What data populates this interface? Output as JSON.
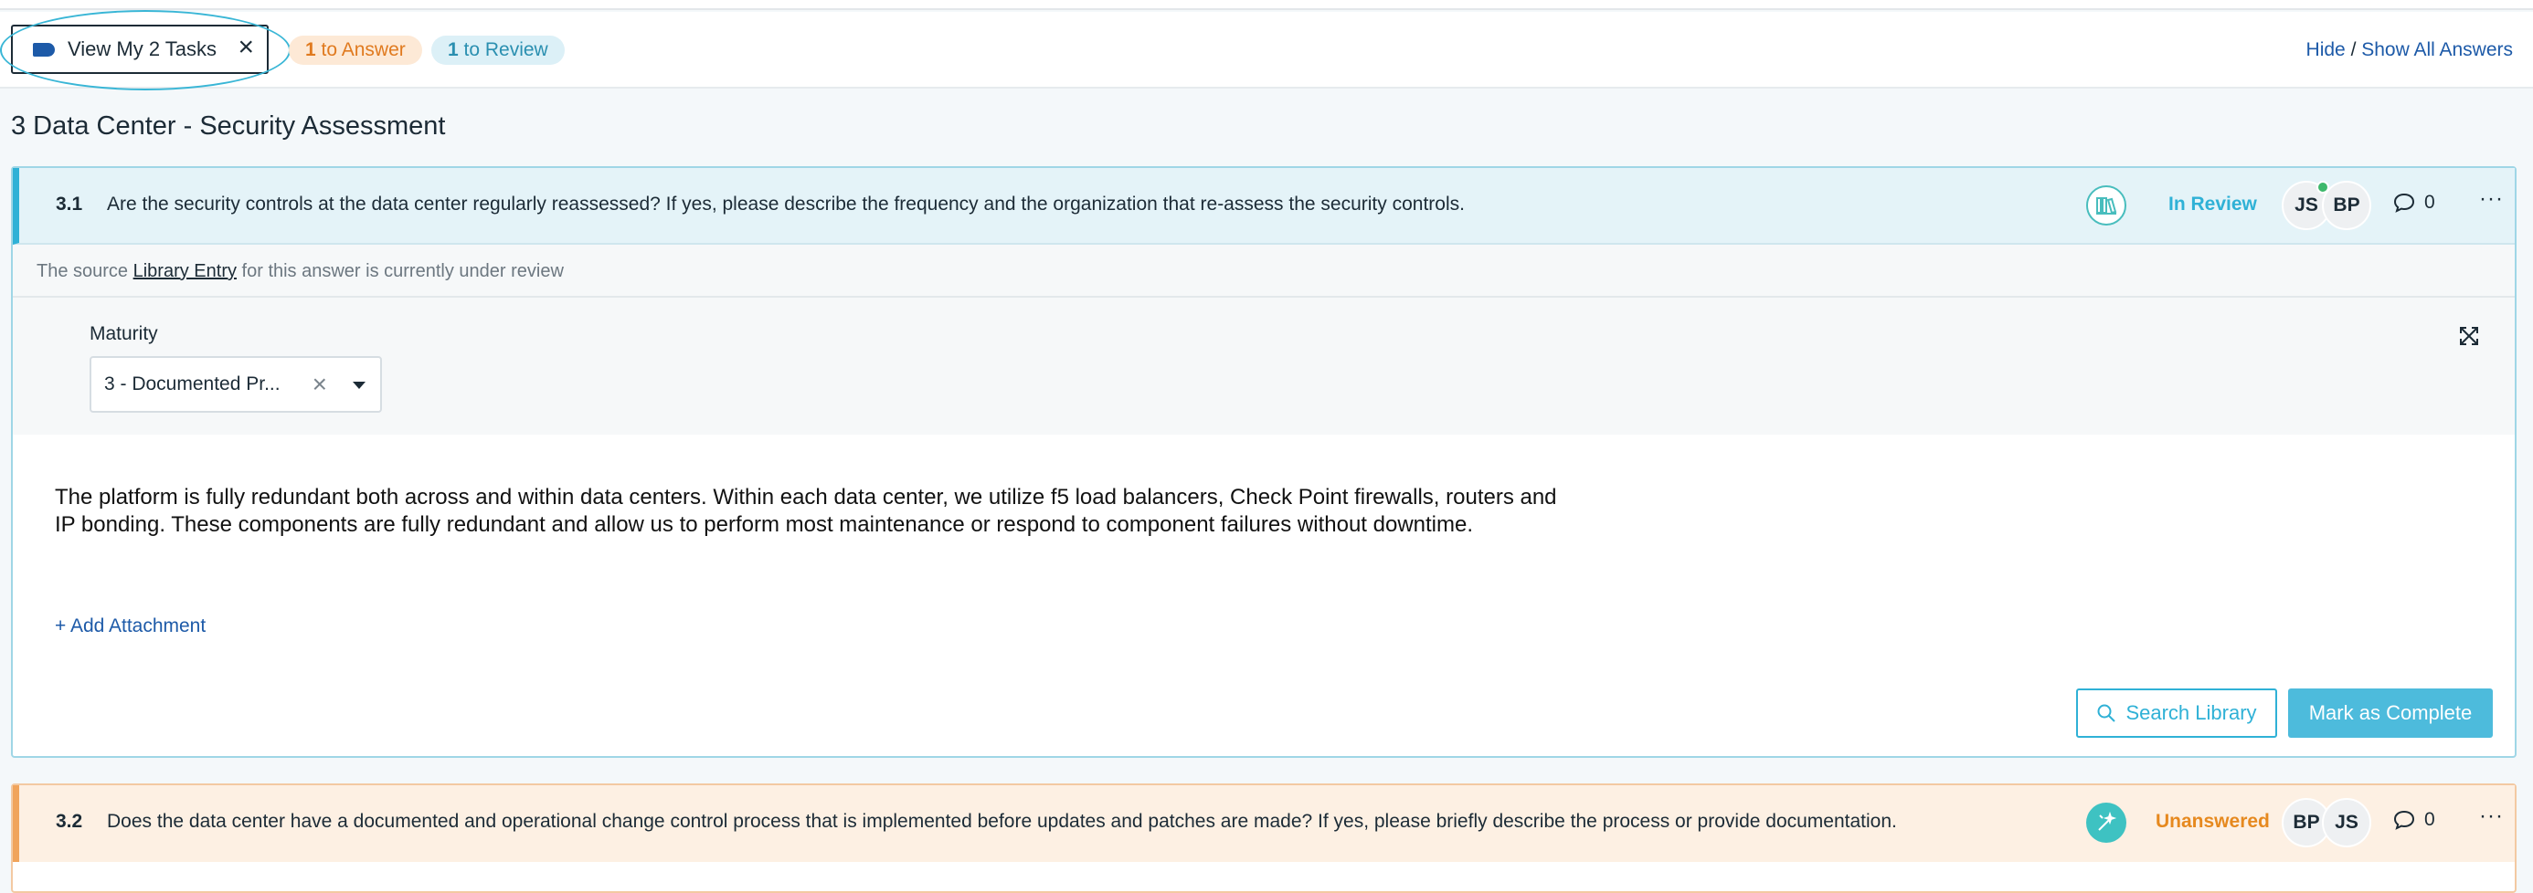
{
  "toolbar": {
    "view_tasks_label": "View My 2 Tasks",
    "to_answer_count": "1",
    "to_answer_label": " to Answer",
    "to_review_count": "1",
    "to_review_label": " to Review",
    "hide_label": "Hide",
    "separator": " / ",
    "show_all_label": "Show All Answers"
  },
  "section": {
    "title": "3 Data Center - Security Assessment"
  },
  "questions": [
    {
      "number": "3.1",
      "text": "Are the security controls at the data center regularly reassessed? If yes, please describe the frequency and the organization that re-assess the security controls.",
      "status": "In Review",
      "avatars": [
        "JS",
        "BP"
      ],
      "comment_count": "0",
      "source_prefix": "The source ",
      "source_link": "Library Entry",
      "source_suffix": " for this answer is currently under review",
      "maturity_label": "Maturity",
      "maturity_value": "3 - Documented Pr...",
      "answer": "The platform is fully redundant both across and within data centers. Within each data center, we utilize f5 load balancers, Check Point firewalls, routers and IP bonding. These components are fully redundant and allow us to perform most maintenance or respond to component failures without downtime.",
      "add_attachment": "+ Add Attachment",
      "search_library": "Search Library",
      "mark_complete": "Mark as Complete"
    },
    {
      "number": "3.2",
      "text": "Does the data center have a documented and operational change control process that is implemented before updates and patches are made? If yes, please briefly describe the process or provide documentation.",
      "status": "Unanswered",
      "avatars": [
        "BP",
        "JS"
      ],
      "comment_count": "0"
    }
  ],
  "icons": {
    "tag": "tag-icon",
    "close": "close-icon",
    "library": "library-icon",
    "wand": "magic-wand-icon",
    "comment": "comment-icon",
    "more": "more-icon",
    "expand": "expand-icon",
    "search": "search-icon"
  },
  "colors": {
    "accent": "#2fb1d6",
    "link": "#1d5aa8",
    "answer_pill": "#e07a1f",
    "review_pill": "#2a8fb0",
    "unanswered": "#e6891f"
  }
}
